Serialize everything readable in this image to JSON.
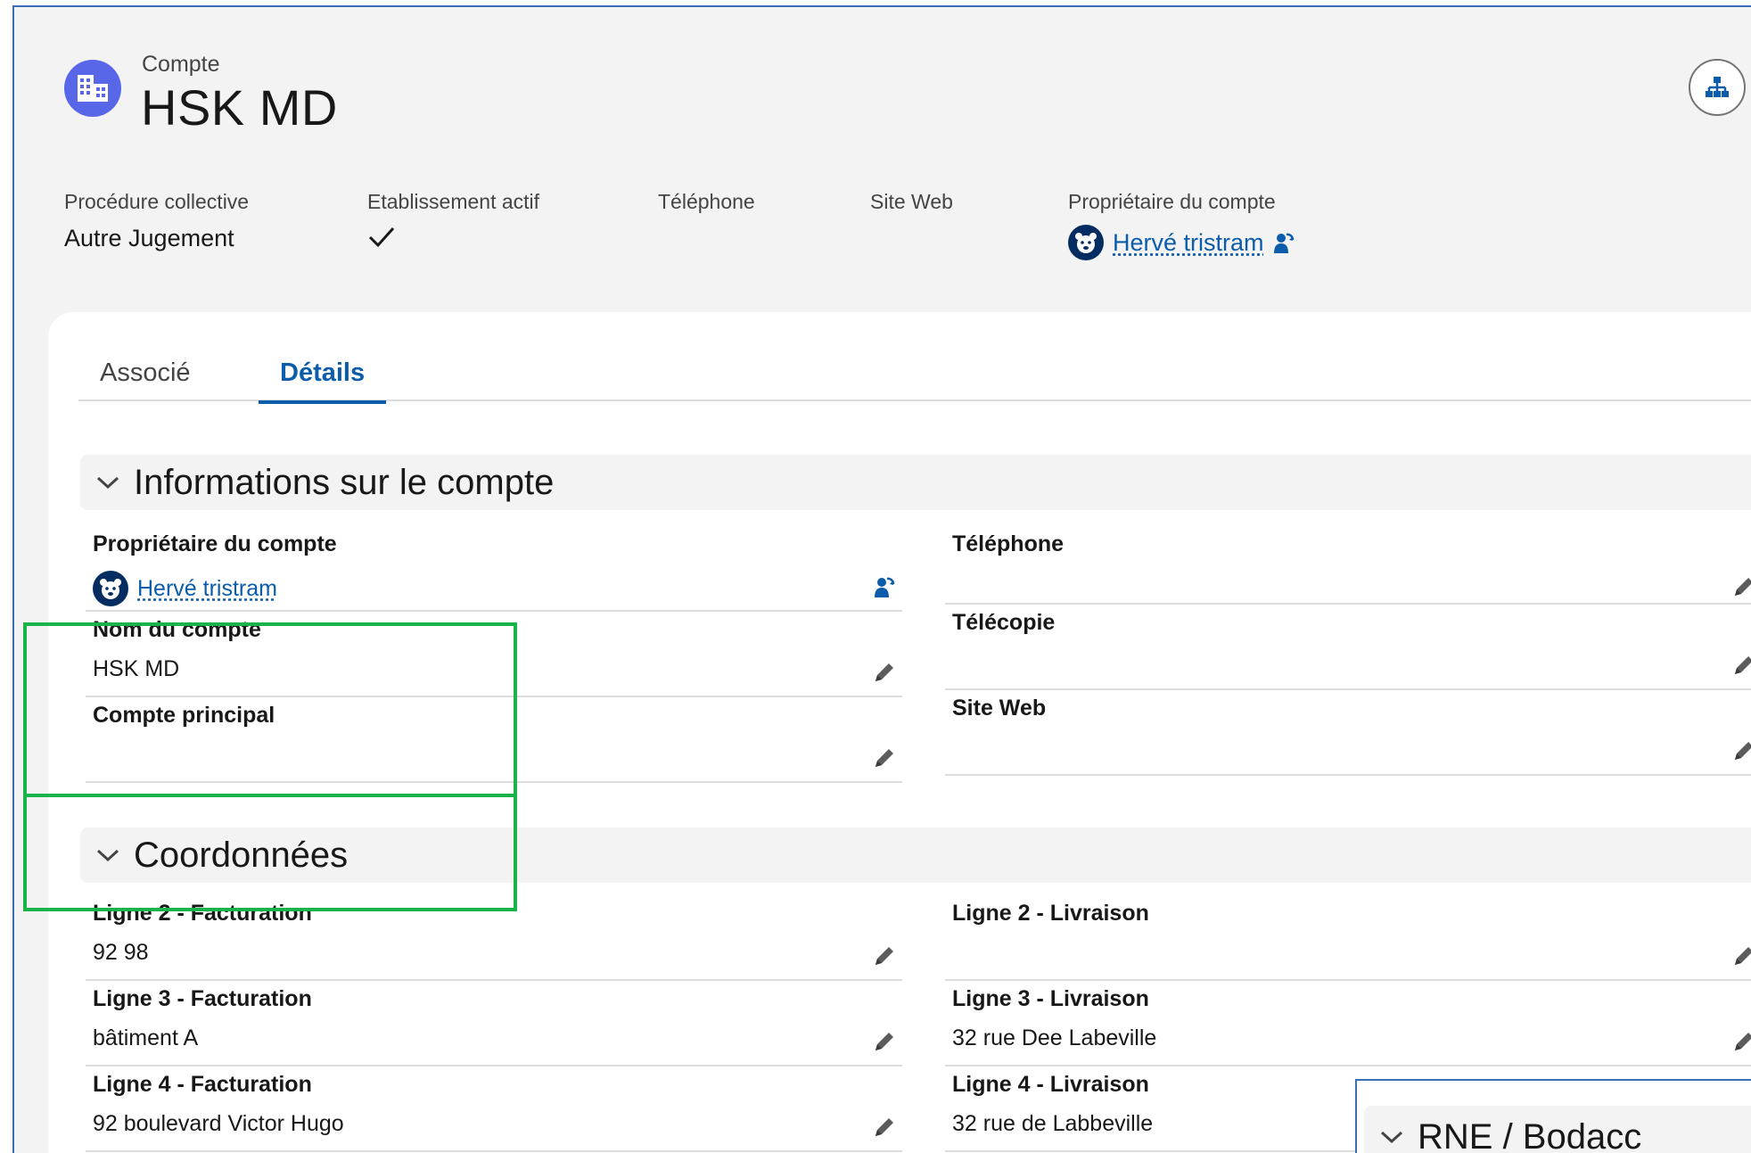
{
  "header": {
    "object_label": "Compte",
    "title": "HSK MD",
    "account_icon": "building-icon",
    "hierarchy_icon": "hierarchy-icon"
  },
  "highlights": [
    {
      "label": "Procédure collective",
      "value": "Autre Jugement"
    },
    {
      "label": "Etablissement actif",
      "value_icon": "check-icon"
    },
    {
      "label": "Téléphone",
      "value": ""
    },
    {
      "label": "Site Web",
      "value": ""
    },
    {
      "label": "Propriétaire du compte",
      "value": "Hervé tristram",
      "icon": "change-owner-icon"
    }
  ],
  "tabs": [
    {
      "label": "Associé",
      "active": false
    },
    {
      "label": "Détails",
      "active": true
    }
  ],
  "sections": {
    "account_info": {
      "title": "Informations sur le compte",
      "left": [
        {
          "label": "Propriétaire du compte",
          "value": "Hervé tristram"
        },
        {
          "label": "Nom du compte",
          "value": "HSK MD"
        },
        {
          "label": "Compte principal",
          "value": ""
        }
      ],
      "right": [
        {
          "label": "Téléphone",
          "value": ""
        },
        {
          "label": "Télécopie",
          "value": ""
        },
        {
          "label": "Site Web",
          "value": ""
        }
      ]
    },
    "coordinates": {
      "title": "Coordonnées",
      "left": [
        {
          "label": "Ligne 2 - Facturation",
          "value": "92 98"
        },
        {
          "label": "Ligne 3 - Facturation",
          "value": "bâtiment A"
        },
        {
          "label": "Ligne 4 - Facturation",
          "value": "92 boulevard Victor Hugo"
        }
      ],
      "right": [
        {
          "label": "Ligne 2 - Livraison",
          "value": ""
        },
        {
          "label": "Ligne 3 - Livraison",
          "value": "32 rue Dee Labeville"
        },
        {
          "label": "Ligne 4 - Livraison",
          "value": "32 rue de Labbeville"
        }
      ]
    },
    "rne": {
      "title": "RNE / Bodacc"
    }
  },
  "colors": {
    "brand_blue": "#0b5cab",
    "icon_purple": "#5867e8",
    "highlight_green": "#19b34a"
  }
}
